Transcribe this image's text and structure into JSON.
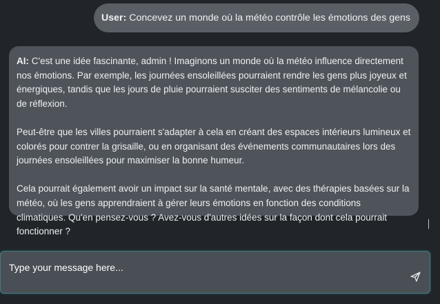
{
  "conversation": {
    "user_message": {
      "speaker": "User:",
      "text": "Concevez un monde où la météo contrôle les émotions des gens"
    },
    "ai_message": {
      "speaker": "AI:",
      "paragraphs": [
        "C'est une idée fascinante, admin ! Imaginons un monde où la météo influence directement nos émotions. Par exemple, les journées ensoleillées pourraient rendre les gens plus joyeux et énergiques, tandis que les jours de pluie pourraient susciter des sentiments de mélancolie ou de réflexion.",
        "Peut-être que les villes pourraient s'adapter à cela en créant des espaces intérieurs lumineux et colorés pour contrer la grisaille, ou en organisant des événements communautaires lors des journées ensoleillées pour maximiser la bonne humeur.",
        "Cela pourrait également avoir un impact sur la santé mentale, avec des thérapies basées sur la météo, où les gens apprendraient à gérer leurs émotions en fonction des conditions climatiques. Qu'en pensez-vous ? Avez-vous d'autres idées sur la façon dont cela pourrait fonctionner ?"
      ]
    }
  },
  "composer": {
    "placeholder": "Type your message here...",
    "value": "",
    "send_icon": "send-icon"
  },
  "colors": {
    "background": "#212529",
    "user_bubble": "#5a5f66",
    "ai_bubble": "#4f545b",
    "composer_border": "#3f7d82"
  }
}
